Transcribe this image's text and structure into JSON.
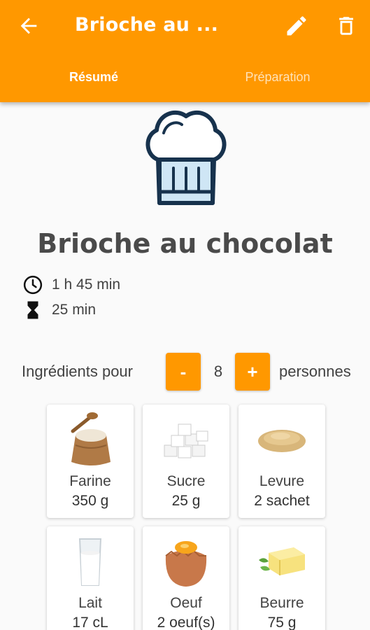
{
  "header": {
    "title": "Brioche au ...",
    "tabs": [
      "Résumé",
      "Préparation"
    ],
    "accent": "#ff9800"
  },
  "recipe": {
    "title": "Brioche au chocolat",
    "icon": "chef-hat-icon",
    "total_time": "1 h 45 min",
    "prep_time": "25 min"
  },
  "servings": {
    "prefix": "Ingrédients pour",
    "minus": "-",
    "count": "8",
    "plus": "+",
    "suffix": "personnes"
  },
  "ingredients": [
    {
      "name": "Farine",
      "qty": "350 g",
      "icon": "flour-sack-icon"
    },
    {
      "name": "Sucre",
      "qty": "25 g",
      "icon": "sugar-cubes-icon"
    },
    {
      "name": "Levure",
      "qty": "2 sachet",
      "icon": "yeast-pile-icon"
    },
    {
      "name": "Lait",
      "qty": "17 cL",
      "icon": "milk-glass-icon"
    },
    {
      "name": "Oeuf",
      "qty": "2 oeuf(s)",
      "icon": "egg-icon"
    },
    {
      "name": "Beurre",
      "qty": "75 g",
      "icon": "butter-icon"
    }
  ]
}
